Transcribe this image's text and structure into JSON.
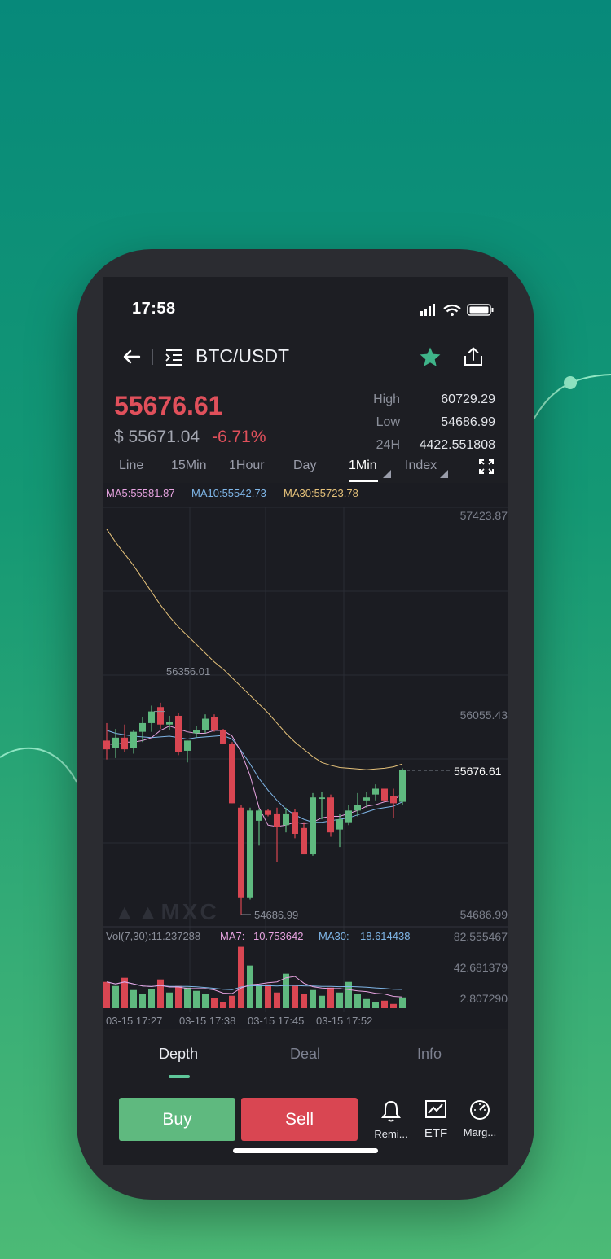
{
  "status_bar": {
    "time": "17:58"
  },
  "header": {
    "pair": "BTC/USDT"
  },
  "ticker": {
    "last_price": "55676.61",
    "usd_price": "$ 55671.04",
    "change": "-6.71%",
    "high_label": "High",
    "high_value": "60729.29",
    "low_label": "Low",
    "low_value": "54686.99",
    "vol_label": "24H",
    "vol_value": "4422.551808"
  },
  "intervals": [
    "Line",
    "15Min",
    "1Hour",
    "Day",
    "1Min",
    "Index"
  ],
  "active_interval": "1Min",
  "ma_legend": {
    "ma5": "MA5:55581.87",
    "ma10": "MA10:55542.73",
    "ma30": "MA30:55723.78"
  },
  "price_axis": {
    "top": "57423.87",
    "mid": "56055.43",
    "bottom": "54686.99"
  },
  "annotations": {
    "high_mark": "56356.01",
    "low_mark": "54686.99",
    "last_price_tag": "55676.61"
  },
  "watermark": "MXC",
  "volume_legend": {
    "vol": "Vol(7,30):11.237288",
    "ma7_label": "MA7:",
    "ma7_value": "10.753642",
    "ma30_label": "MA30:",
    "ma30_value": "18.614438"
  },
  "volume_axis": {
    "top": "82.555467",
    "mid": "42.681379",
    "bottom": "2.807290"
  },
  "time_axis": [
    "03-15 17:27",
    "03-15 17:38",
    "03-15 17:45",
    "03-15 17:52"
  ],
  "bottom_tabs": [
    "Depth",
    "Deal",
    "Info"
  ],
  "actions": {
    "buy": "Buy",
    "sell": "Sell"
  },
  "tools": [
    {
      "label": "Remi...",
      "icon": "bell-icon"
    },
    {
      "label": "ETF",
      "icon": "etf-chart-icon"
    },
    {
      "label": "Marg...",
      "icon": "gauge-icon"
    }
  ],
  "colors": {
    "up": "#5fb97f",
    "down": "#d94652",
    "ma5": "#e7a3e0",
    "ma10": "#7fb6e8",
    "ma30": "#e6c27a",
    "star": "#3fb489"
  },
  "chart_data": {
    "type": "candlestick",
    "series": [
      {
        "o": 55880,
        "h": 56000,
        "l": 55750,
        "c": 55820
      },
      {
        "o": 55830,
        "h": 55960,
        "l": 55760,
        "c": 55900
      },
      {
        "o": 55900,
        "h": 55990,
        "l": 55800,
        "c": 55820
      },
      {
        "o": 55830,
        "h": 55950,
        "l": 55790,
        "c": 55940
      },
      {
        "o": 55940,
        "h": 56040,
        "l": 55870,
        "c": 56000
      },
      {
        "o": 56000,
        "h": 56120,
        "l": 55940,
        "c": 56080
      },
      {
        "o": 56110,
        "h": 56140,
        "l": 55960,
        "c": 55990
      },
      {
        "o": 55990,
        "h": 56050,
        "l": 55950,
        "c": 56010
      },
      {
        "o": 56050,
        "h": 56070,
        "l": 55780,
        "c": 55800
      },
      {
        "o": 55810,
        "h": 55880,
        "l": 55730,
        "c": 55880
      },
      {
        "o": 55930,
        "h": 55980,
        "l": 55900,
        "c": 55950
      },
      {
        "o": 55950,
        "h": 56060,
        "l": 55930,
        "c": 56030
      },
      {
        "o": 56040,
        "h": 56060,
        "l": 55940,
        "c": 55950
      },
      {
        "o": 55950,
        "h": 55960,
        "l": 55860,
        "c": 55860
      },
      {
        "o": 55860,
        "h": 55870,
        "l": 55450,
        "c": 55450
      },
      {
        "o": 55420,
        "h": 55440,
        "l": 54687,
        "c": 54800
      },
      {
        "o": 54800,
        "h": 55420,
        "l": 54790,
        "c": 55400
      },
      {
        "o": 55330,
        "h": 55410,
        "l": 55160,
        "c": 55400
      },
      {
        "o": 55400,
        "h": 55410,
        "l": 55360,
        "c": 55370
      },
      {
        "o": 55380,
        "h": 55420,
        "l": 55050,
        "c": 55290
      },
      {
        "o": 55300,
        "h": 55420,
        "l": 55250,
        "c": 55380
      },
      {
        "o": 55390,
        "h": 55410,
        "l": 55210,
        "c": 55240
      },
      {
        "o": 55280,
        "h": 55320,
        "l": 55100,
        "c": 55100
      },
      {
        "o": 55100,
        "h": 55520,
        "l": 55090,
        "c": 55490
      },
      {
        "o": 55480,
        "h": 55530,
        "l": 55340,
        "c": 55490
      },
      {
        "o": 55490,
        "h": 55510,
        "l": 55220,
        "c": 55250
      },
      {
        "o": 55270,
        "h": 55380,
        "l": 55150,
        "c": 55340
      },
      {
        "o": 55320,
        "h": 55440,
        "l": 55300,
        "c": 55400
      },
      {
        "o": 55400,
        "h": 55520,
        "l": 55360,
        "c": 55440
      },
      {
        "o": 55470,
        "h": 55530,
        "l": 55420,
        "c": 55490
      },
      {
        "o": 55510,
        "h": 55580,
        "l": 55470,
        "c": 55550
      },
      {
        "o": 55550,
        "h": 55550,
        "l": 55460,
        "c": 55470
      },
      {
        "o": 55500,
        "h": 55550,
        "l": 55350,
        "c": 55450
      },
      {
        "o": 55460,
        "h": 55690,
        "l": 55440,
        "c": 55676.61
      }
    ],
    "ma5": [
      55860,
      55850,
      55870,
      55870,
      55880,
      55900,
      55950,
      55980,
      55960,
      55940,
      55930,
      55930,
      55950,
      55950,
      55910,
      55800,
      55640,
      55420,
      55300,
      55290,
      55300,
      55320,
      55310,
      55320,
      55350,
      55360,
      55360,
      55380,
      55400,
      55430,
      55440,
      55460,
      55470,
      55520
    ],
    "ma10": [
      55950,
      55930,
      55920,
      55910,
      55905,
      55900,
      55905,
      55910,
      55900,
      55890,
      55900,
      55905,
      55910,
      55915,
      55890,
      55810,
      55720,
      55620,
      55540,
      55470,
      55410,
      55370,
      55340,
      55320,
      55320,
      55330,
      55340,
      55350,
      55370,
      55390,
      55410,
      55420,
      55430,
      55460
    ],
    "ma30": [
      57330,
      57240,
      57160,
      57080,
      56990,
      56900,
      56810,
      56730,
      56660,
      56600,
      56540,
      56480,
      56420,
      56370,
      56310,
      56250,
      56190,
      56130,
      56070,
      56000,
      55930,
      55870,
      55820,
      55770,
      55730,
      55710,
      55695,
      55690,
      55685,
      55680,
      55685,
      55690,
      55700,
      55720
    ],
    "volume": [
      35,
      30,
      40,
      25,
      20,
      26,
      38,
      22,
      30,
      28,
      24,
      20,
      15,
      10,
      18,
      78,
      55,
      30,
      32,
      22,
      45,
      30,
      20,
      25,
      18,
      28,
      22,
      35,
      20,
      14,
      10,
      12,
      8,
      16
    ],
    "price_range": [
      54686.99,
      57423.87
    ],
    "volume_range": [
      2.80729,
      82.555467
    ]
  }
}
